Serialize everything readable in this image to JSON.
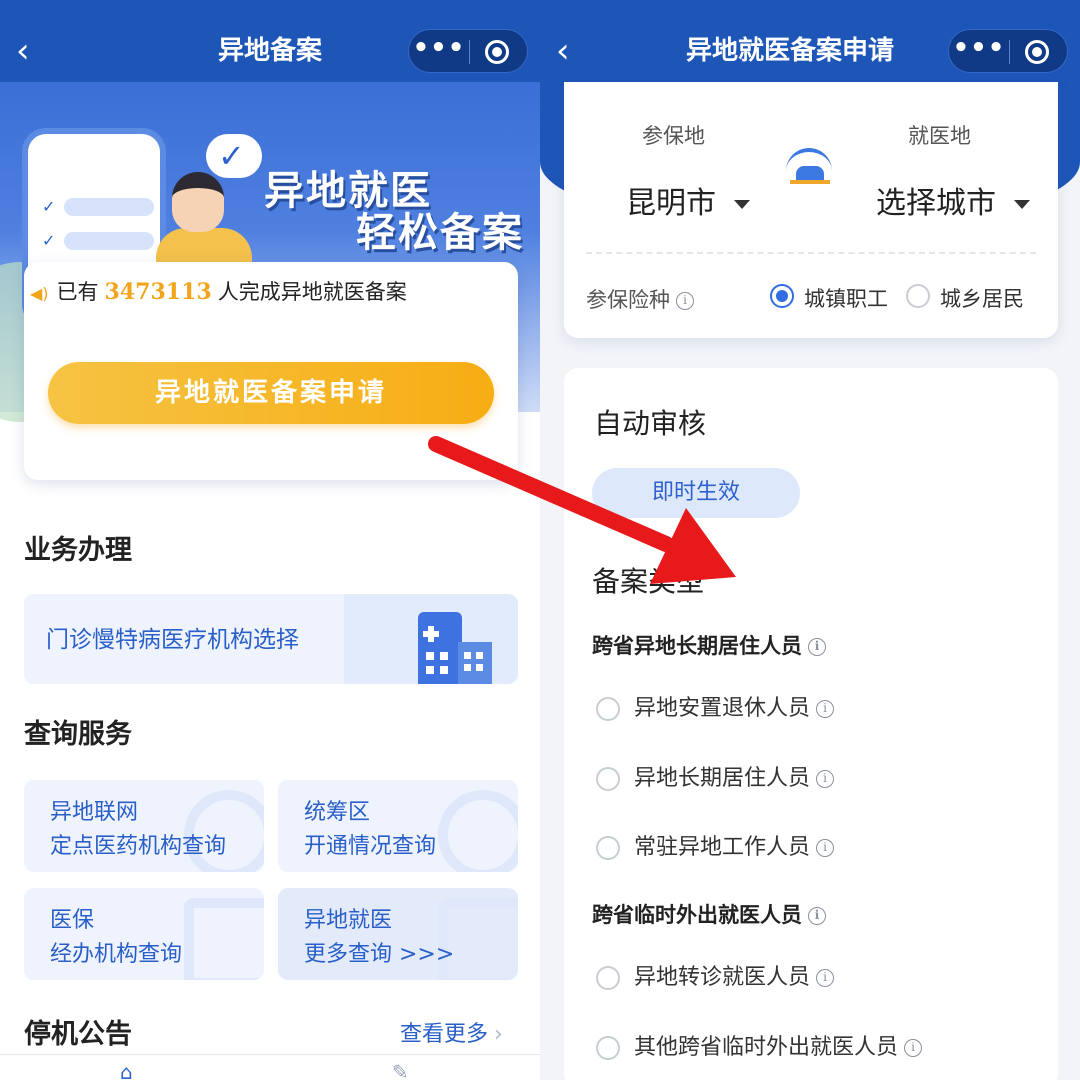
{
  "left_screen": {
    "nav": {
      "back_icon": "chevron-left",
      "title": "异地备案",
      "more_icon": "more-dots",
      "close_icon": "capsule-target"
    },
    "banner": {
      "title_line1": "异地就医",
      "title_line2": "轻松备案"
    },
    "notice": {
      "prefix": "已有",
      "count": "3473113",
      "suffix": "人完成异地就医备案",
      "icon": "speaker-icon"
    },
    "apply_button": "异地就医备案申请",
    "business": {
      "title": "业务办理",
      "items": [
        {
          "label": "门诊慢特病医疗机构选择",
          "icon": "hospital-icon"
        }
      ]
    },
    "query": {
      "title": "查询服务",
      "cards": [
        {
          "line1": "异地联网",
          "line2": "定点医药机构查询"
        },
        {
          "line1": "统筹区",
          "line2": "开通情况查询"
        },
        {
          "line1": "医保",
          "line2": "经办机构查询"
        },
        {
          "line1": "异地就医",
          "line2": "更多查询 >>>"
        }
      ]
    },
    "downtime": {
      "title": "停机公告",
      "more": "查看更多"
    }
  },
  "right_screen": {
    "nav": {
      "back_icon": "chevron-left",
      "title": "异地就医备案申请",
      "more_icon": "more-dots",
      "close_icon": "capsule-target"
    },
    "location": {
      "insured_label": "参保地",
      "insured_value": "昆明市",
      "treatment_label": "就医地",
      "treatment_value": "选择城市",
      "swap_icon": "swap-city-icon"
    },
    "insurance": {
      "label": "参保险种",
      "options": [
        {
          "label": "城镇职工",
          "selected": true
        },
        {
          "label": "城乡居民",
          "selected": false
        }
      ]
    },
    "auto_review": {
      "title": "自动审核",
      "badge": "即时生效"
    },
    "record_type": {
      "title": "备案类型",
      "groups": [
        {
          "title": "跨省异地长期居住人员",
          "items": [
            "异地安置退休人员",
            "异地长期居住人员",
            "常驻异地工作人员"
          ]
        },
        {
          "title": "跨省临时外出就医人员",
          "items": [
            "异地转诊就医人员",
            "其他跨省临时外出就医人员"
          ]
        }
      ]
    }
  },
  "annotation": {
    "arrow_color": "#e8191b"
  },
  "colors": {
    "nav": "#1e56b8",
    "accent": "#2f62cf",
    "button": "#f7ad13",
    "count": "#f2a51c"
  }
}
